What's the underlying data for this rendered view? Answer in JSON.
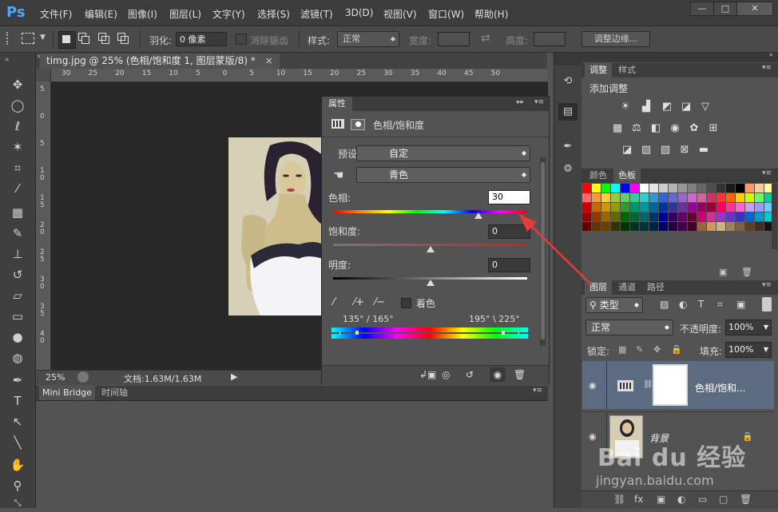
{
  "app": {
    "logo": "Ps",
    "menus": [
      "文件(F)",
      "编辑(E)",
      "图像(I)",
      "图层(L)",
      "文字(Y)",
      "选择(S)",
      "滤镜(T)",
      "3D(D)",
      "视图(V)",
      "窗口(W)",
      "帮助(H)"
    ],
    "window_buttons": [
      "—",
      "□",
      "✕"
    ]
  },
  "options_bar": {
    "feather_label": "羽化:",
    "feather_value": "0 像素",
    "antialias_label": "消除锯齿",
    "style_label": "样式:",
    "style_value": "正常",
    "width_label": "宽度:",
    "height_label": "高度:",
    "refine_edge_button": "调整边缘..."
  },
  "document": {
    "tab_title": "timg.jpg @ 25% (色相/饱和度 1, 图层蒙版/8) *",
    "close": "×",
    "ruler_h_numbers": [
      "30",
      "25",
      "20",
      "15",
      "10",
      "5",
      "0",
      "5",
      "10",
      "15",
      "20",
      "25",
      "30",
      "35",
      "40",
      "45",
      "50"
    ],
    "ruler_v_numbers": [
      "5",
      "0",
      "5",
      "1 0",
      "1 5",
      "2 0",
      "2 5",
      "3 0",
      "3 5",
      "4 0"
    ],
    "zoom": "25%",
    "doc_size": "文档:1.63M/1.63M"
  },
  "bottom_panel": {
    "tabs": [
      "Mini Bridge",
      "时间轴"
    ]
  },
  "properties": {
    "tab": "属性",
    "title": "色相/饱和度",
    "preset_label": "预设:",
    "preset_value": "自定",
    "channel_value": "青色",
    "hue_label": "色相:",
    "hue_value": "30",
    "sat_label": "饱和度:",
    "sat_value": "0",
    "light_label": "明度:",
    "light_value": "0",
    "colorize_label": "着色",
    "range_left": "135° / 165°",
    "range_right": "195° \\ 225°",
    "hue_level": 0.75,
    "sat_level": 0.5,
    "light_level": 0.5
  },
  "right_panel": {
    "adjust_tabs": [
      "调整",
      "样式"
    ],
    "adjust_title": "添加调整",
    "color_tabs": [
      "颜色",
      "色板"
    ],
    "layers_tabs": [
      "图层",
      "通道",
      "路径"
    ],
    "filter_kind": "类型",
    "blend_mode": "正常",
    "opacity_label": "不透明度:",
    "opacity_value": "100%",
    "lock_label": "锁定:",
    "fill_label": "填充:",
    "fill_value": "100%",
    "layers": [
      {
        "name": "色相/饱和...",
        "selected": true
      },
      {
        "name": "背景",
        "selected": false
      }
    ]
  },
  "watermark": {
    "brand": "Bai du 经验",
    "url": "jingyan.baidu.com"
  },
  "swatch_colors": [
    [
      "#ff0000",
      "#ffff00",
      "#00ff00",
      "#00ffff",
      "#0000ff",
      "#ff00ff",
      "#ffffff",
      "#e6e6e6",
      "#cccccc",
      "#b3b3b3",
      "#999999",
      "#808080",
      "#666666",
      "#4d4d4d",
      "#333333",
      "#1a1a1a",
      "#000000",
      "#ff9966",
      "#ffcc99",
      "#ffff99"
    ],
    [
      "#ff6666",
      "#ff9933",
      "#ffcc33",
      "#99cc33",
      "#66cc66",
      "#33cc99",
      "#33cccc",
      "#3399cc",
      "#3366cc",
      "#6666cc",
      "#9966cc",
      "#cc66cc",
      "#cc6699",
      "#cc3366",
      "#ff3333",
      "#ff6600",
      "#ffcc00",
      "#ccff00",
      "#66ff66",
      "#00cc99"
    ],
    [
      "#cc0000",
      "#cc6600",
      "#cc9900",
      "#999900",
      "#339933",
      "#009966",
      "#009999",
      "#006699",
      "#003399",
      "#333399",
      "#663399",
      "#990099",
      "#990066",
      "#990033",
      "#ff0066",
      "#ff3399",
      "#ff66cc",
      "#cc99ff",
      "#9999ff",
      "#66ccff"
    ],
    [
      "#990000",
      "#993300",
      "#996600",
      "#666600",
      "#006600",
      "#006633",
      "#006666",
      "#003366",
      "#000099",
      "#330066",
      "#660066",
      "#660033",
      "#cc0066",
      "#cc3399",
      "#9933cc",
      "#6633cc",
      "#3333cc",
      "#0066cc",
      "#0099cc",
      "#00cccc"
    ],
    [
      "#660000",
      "#663300",
      "#664400",
      "#333300",
      "#003300",
      "#003322",
      "#003333",
      "#002244",
      "#000066",
      "#220044",
      "#440044",
      "#440022",
      "#996633",
      "#cc9966",
      "#ccb380",
      "#a08060",
      "#806040",
      "#604020",
      "#403020",
      "#201008"
    ]
  ]
}
